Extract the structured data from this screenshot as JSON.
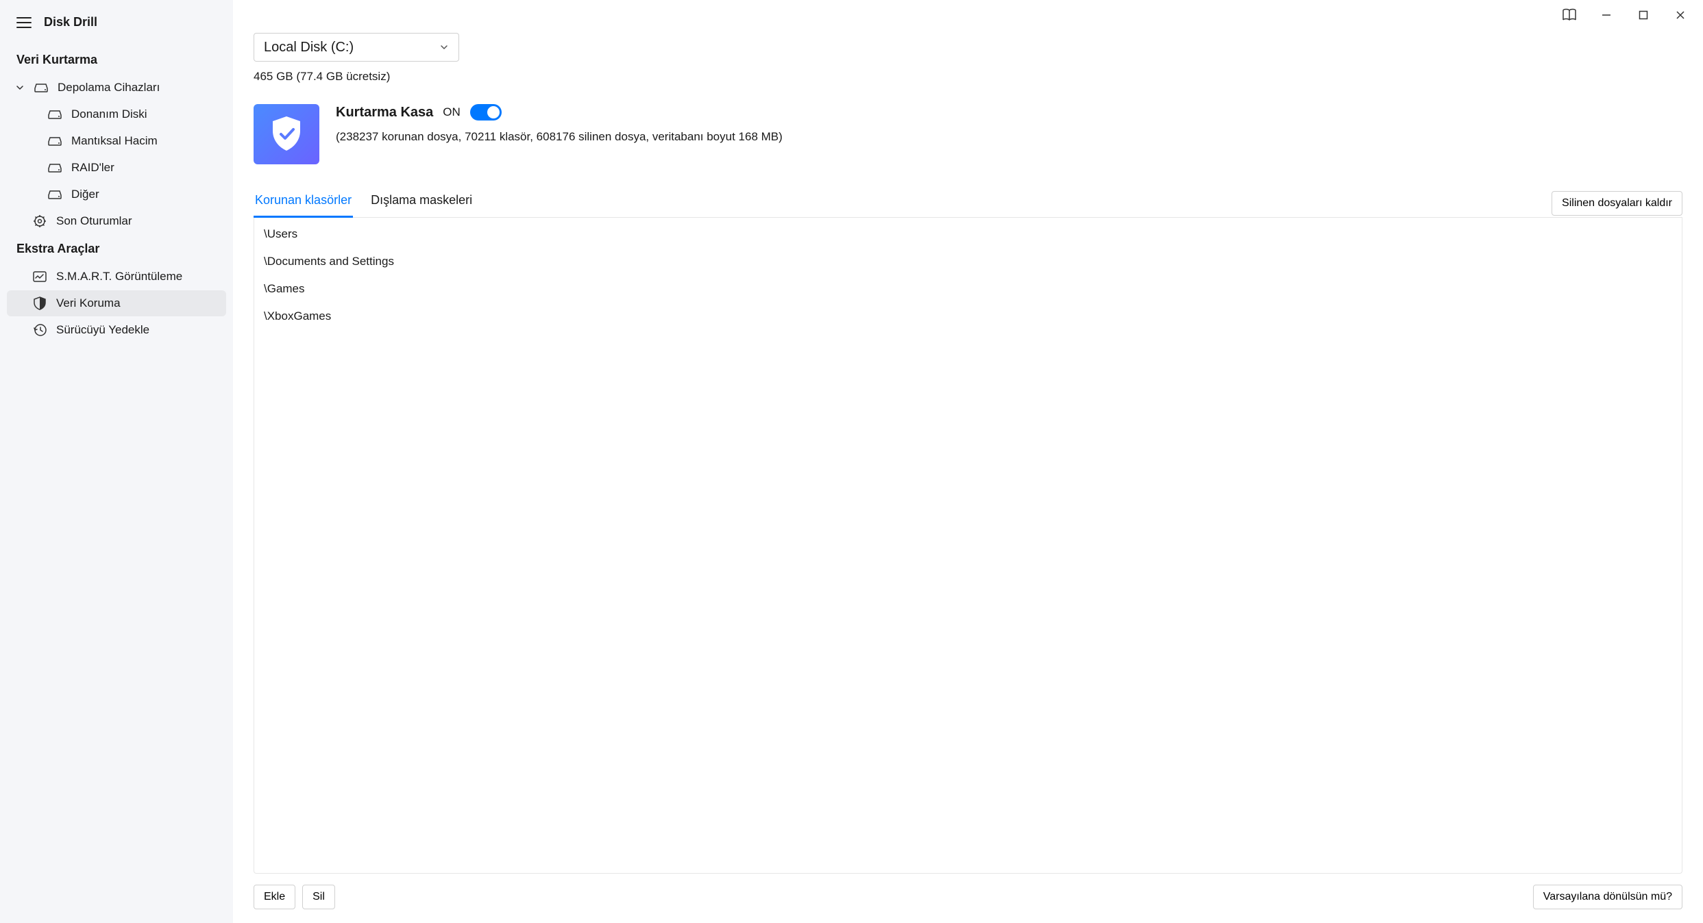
{
  "app": {
    "title": "Disk Drill"
  },
  "sidebar": {
    "section_recovery": "Veri Kurtarma",
    "storage_devices": "Depolama Cihazları",
    "hardware_disk": "Donanım Diski",
    "logical_volume": "Mantıksal Hacim",
    "raid": "RAID'ler",
    "other": "Diğer",
    "recent_sessions": "Son Oturumlar",
    "section_extra": "Ekstra Araçlar",
    "smart": "S.M.A.R.T. Görüntüleme",
    "data_protection": "Veri Koruma",
    "backup_drive": "Sürücüyü Yedekle"
  },
  "disk": {
    "selected": "Local Disk (C:)",
    "info": "465 GB (77.4 GB ücretsiz)"
  },
  "vault": {
    "title": "Kurtarma Kasa",
    "on_label": "ON",
    "stats": "(238237 korunan dosya, 70211 klasör, 608176 silinen dosya, veritabanı boyut 168 MB)"
  },
  "tabs": {
    "protected": "Korunan klasörler",
    "exclusion": "Dışlama maskeleri"
  },
  "buttons": {
    "remove_deleted": "Silinen dosyaları kaldır",
    "add": "Ekle",
    "delete": "Sil",
    "reset_default": "Varsayılana dönülsün mü?"
  },
  "folders": {
    "f0": "\\Users",
    "f1": "\\Documents and Settings",
    "f2": "\\Games",
    "f3": "\\XboxGames"
  }
}
